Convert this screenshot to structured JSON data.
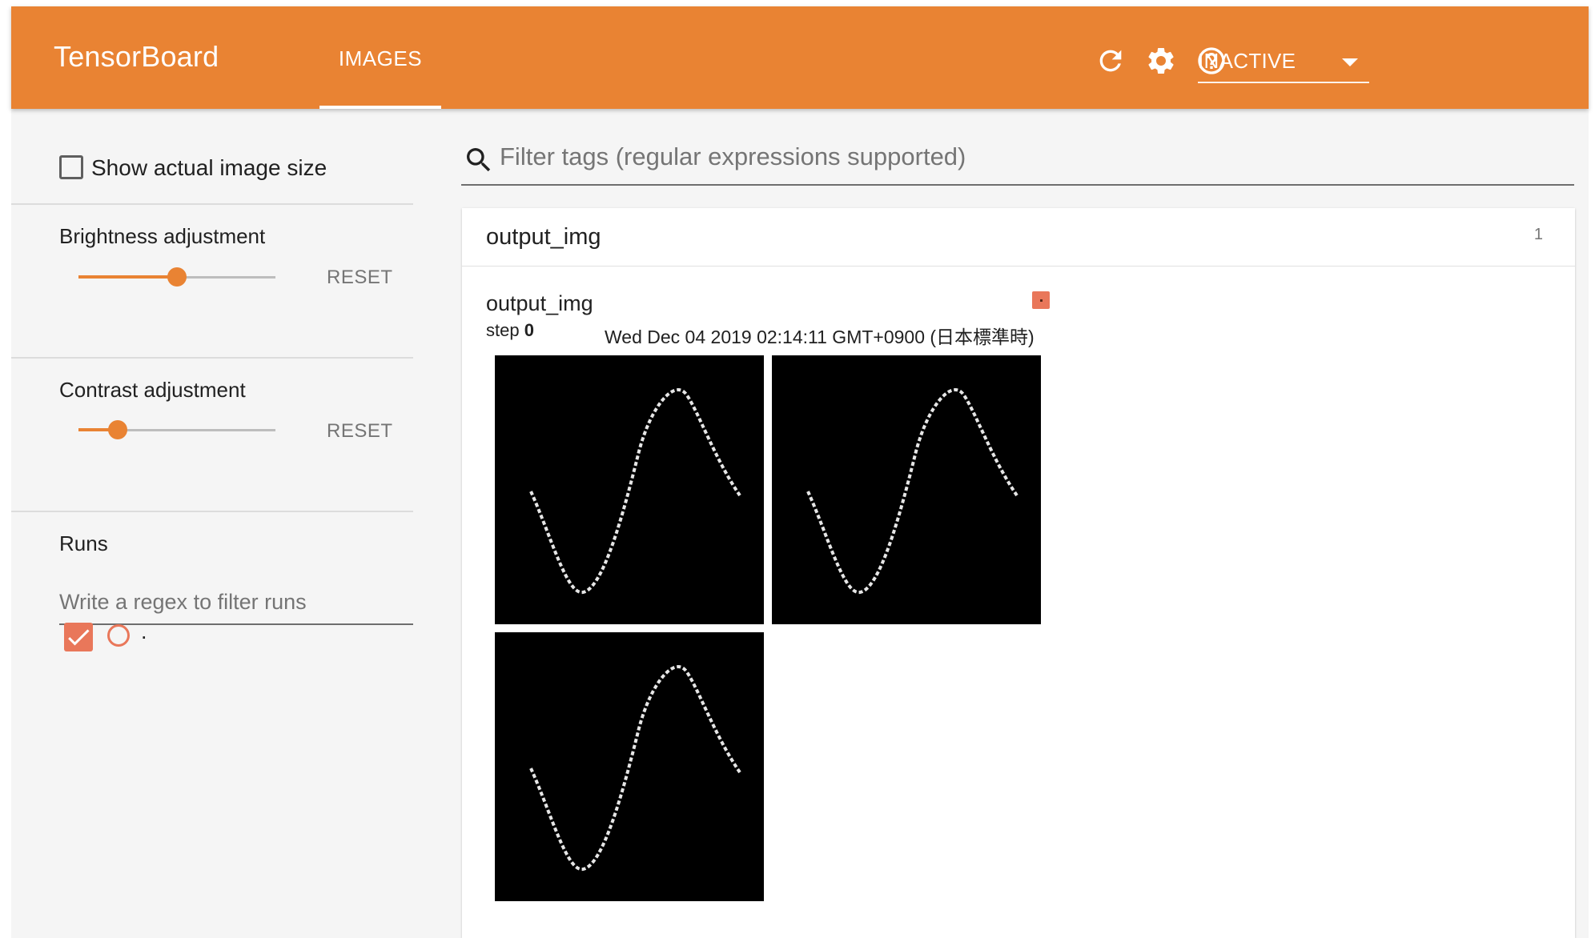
{
  "header": {
    "brand": "TensorBoard",
    "tabs": [
      {
        "label": "IMAGES",
        "active": true
      }
    ],
    "run_selector": {
      "value": "INACTIVE"
    },
    "icons": [
      "refresh-icon",
      "settings-icon",
      "help-icon"
    ]
  },
  "sidebar": {
    "show_actual_size_label": "Show actual image size",
    "brightness": {
      "label": "Brightness adjustment",
      "reset_label": "RESET",
      "value": 0.5
    },
    "contrast": {
      "label": "Contrast adjustment",
      "reset_label": "RESET",
      "value": 0.2
    },
    "runs": {
      "title": "Runs",
      "filter_placeholder": "Write a regex to filter runs",
      "items": [
        {
          "name": ".",
          "checked": true,
          "color": "#e9775a"
        }
      ]
    }
  },
  "main": {
    "filter_placeholder": "Filter tags (regular expressions supported)",
    "category": {
      "title": "output_img",
      "count": "1",
      "card": {
        "title": "output_img",
        "step_label": "step",
        "step_value": "0",
        "timestamp": "Wed Dec 04 2019 02:14:11 GMT+0900 (日本標準時)",
        "image_count": 3
      }
    }
  },
  "colors": {
    "accent": "#e98333",
    "run_color": "#e9775a",
    "sidebar_bg": "#f5f5f5"
  }
}
